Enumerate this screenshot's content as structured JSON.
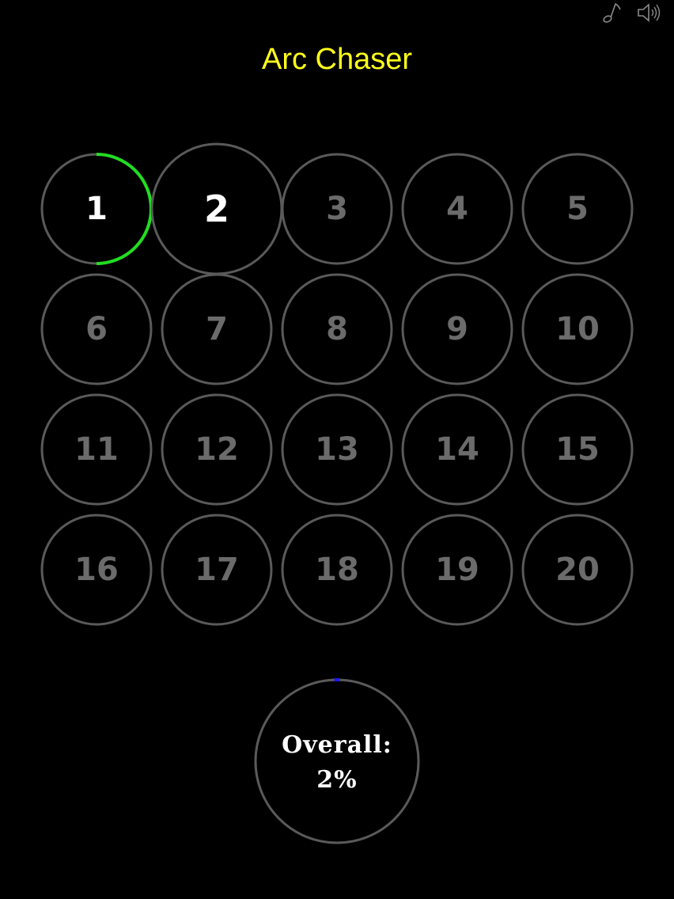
{
  "title": "Arc Chaser",
  "colors": {
    "title": "#ffff1a",
    "ring": "#5a5a5a",
    "label_locked": "#6b6b6b",
    "label_active": "#ffffff",
    "progress_level": "#22dd22",
    "progress_overall": "#1a1aff",
    "icon": "#8a8a8a"
  },
  "icons": {
    "music": "music-note-icon",
    "sound": "speaker-icon"
  },
  "levels": [
    {
      "label": "1",
      "state": "completed-partial",
      "progress": 0.5
    },
    {
      "label": "2",
      "state": "selected",
      "progress": 0
    },
    {
      "label": "3",
      "state": "locked",
      "progress": 0
    },
    {
      "label": "4",
      "state": "locked",
      "progress": 0
    },
    {
      "label": "5",
      "state": "locked",
      "progress": 0
    },
    {
      "label": "6",
      "state": "locked",
      "progress": 0
    },
    {
      "label": "7",
      "state": "locked",
      "progress": 0
    },
    {
      "label": "8",
      "state": "locked",
      "progress": 0
    },
    {
      "label": "9",
      "state": "locked",
      "progress": 0
    },
    {
      "label": "10",
      "state": "locked",
      "progress": 0
    },
    {
      "label": "11",
      "state": "locked",
      "progress": 0
    },
    {
      "label": "12",
      "state": "locked",
      "progress": 0
    },
    {
      "label": "13",
      "state": "locked",
      "progress": 0
    },
    {
      "label": "14",
      "state": "locked",
      "progress": 0
    },
    {
      "label": "15",
      "state": "locked",
      "progress": 0
    },
    {
      "label": "16",
      "state": "locked",
      "progress": 0
    },
    {
      "label": "17",
      "state": "locked",
      "progress": 0
    },
    {
      "label": "18",
      "state": "locked",
      "progress": 0
    },
    {
      "label": "19",
      "state": "locked",
      "progress": 0
    },
    {
      "label": "20",
      "state": "locked",
      "progress": 0
    }
  ],
  "overall": {
    "label": "Overall:",
    "value_text": "2%",
    "progress": 0.02
  }
}
